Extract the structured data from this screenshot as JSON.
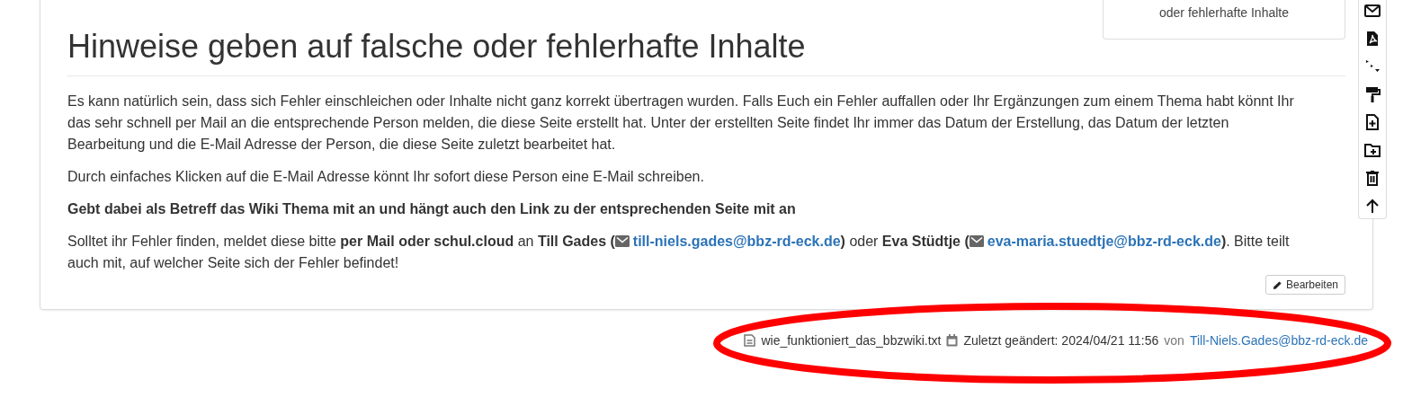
{
  "toc": {
    "text": "oder fehlerhafte Inhalte"
  },
  "toolbar": {
    "items": [
      {
        "kind": "mail"
      },
      {
        "kind": "pdf"
      },
      {
        "kind": "branch"
      },
      {
        "kind": "roller"
      },
      {
        "kind": "file-plus"
      },
      {
        "kind": "folder-plus"
      },
      {
        "kind": "trash"
      },
      {
        "kind": "up"
      }
    ]
  },
  "heading": "Hinweise geben auf falsche oder fehlerhafte Inhalte",
  "paragraphs": [
    {
      "kind": "plain",
      "text": "Es kann natürlich sein, dass sich Fehler einschleichen oder Inhalte nicht ganz korrekt übertragen wurden. Falls Euch ein Fehler auffallen oder Ihr Ergänzungen zum einem Thema habt könnt Ihr das sehr schnell per Mail an die entsprechende Person melden, die diese Seite erstellt hat. Unter der erstellten Seite findet Ihr immer das Datum der Erstellung, das Datum der letzten Bearbeitung und die E-Mail Adresse der Person, die diese Seite zuletzt bearbeitet hat."
    },
    {
      "kind": "plain",
      "text": "Durch einfaches Klicken auf die E-Mail Adresse könnt Ihr sofort diese Person eine E-Mail schreiben."
    },
    {
      "kind": "bold",
      "text": "Gebt dabei als Betreff das Wiki Thema mit an und hängt auch den Link zu der entsprechenden Seite mit an"
    },
    {
      "kind": "mixed",
      "segments": [
        {
          "kind": "text",
          "text": "Solltet ihr Fehler finden, meldet diese bitte **per Mail oder schul.cloud** an **Till Gades (**"
        },
        {
          "kind": "link",
          "text": "till-niels.gades@bbz-rd-eck.de"
        },
        {
          "kind": "text",
          "text": "**)** oder **Eva Stüdtje (**"
        },
        {
          "kind": "link",
          "text": "eva-maria.stuedtje@bbz-rd-eck.de"
        },
        {
          "kind": "text",
          "text": "**)**. Bitte teilt auch mit, auf welcher Seite sich der Fehler befindet!"
        }
      ]
    }
  ],
  "edit_button": {
    "label": "Bearbeiten"
  },
  "footer": {
    "filename": "wie_funktioniert_das_bbzwiki.txt",
    "modified": "Zuletzt geändert: 2024/04/21 11:56",
    "by": "von",
    "author": "Till-Niels.Gades@bbz-rd-eck.de"
  },
  "annotation": {
    "kind": "ellipse",
    "color": "#ff0000"
  }
}
